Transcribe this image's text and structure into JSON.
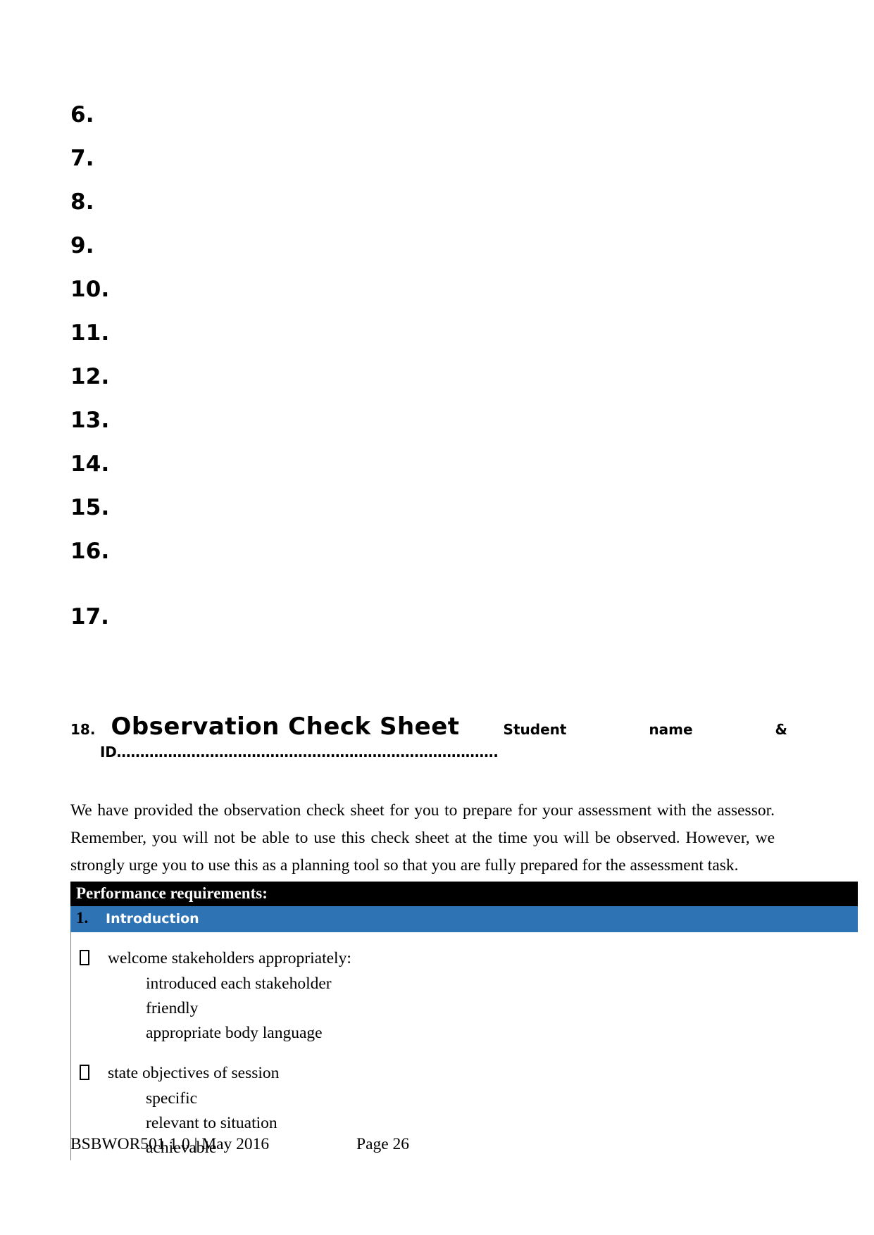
{
  "document": {
    "numbered_list": [
      {
        "num": "6."
      },
      {
        "num": "7."
      },
      {
        "num": "8."
      },
      {
        "num": "9."
      },
      {
        "num": "10."
      },
      {
        "num": "11."
      },
      {
        "num": "12."
      },
      {
        "num": "13."
      },
      {
        "num": "14."
      },
      {
        "num": "15."
      },
      {
        "num": "16."
      }
    ],
    "item17": {
      "num": "17."
    },
    "heading": {
      "num": "18.",
      "title": "Observation Check Sheet",
      "sub_word1": "Student",
      "sub_word2": "name",
      "sub_word3": "&",
      "id_line": "ID………………………………………………………………………."
    },
    "intro_paragraph": "We have provided the observation check sheet for you to prepare for your assessment with the assessor. Remember, you will not be able to use this check sheet at the time you will be observed. However, we strongly urge you to use this as a planning tool so that you are fully prepared for the assessment task.",
    "table": {
      "header_black": "Performance requirements:",
      "section_number": "1.",
      "section_label": "Introduction",
      "groups": [
        {
          "heading": "welcome stakeholders appropriately:",
          "subitems": [
            "introduced each stakeholder",
            "friendly",
            "appropriate body language"
          ]
        },
        {
          "heading": "state objectives of session",
          "subitems": [
            "specific",
            "relevant to situation",
            "achievable"
          ]
        }
      ]
    },
    "footer": {
      "left": "BSBWOR501 1.0 | May 2016",
      "right": "Page 26"
    },
    "colors": {
      "section_blue": "#2E74B5",
      "header_black": "#000000",
      "text": "#000000",
      "border_gray": "#808080"
    }
  }
}
